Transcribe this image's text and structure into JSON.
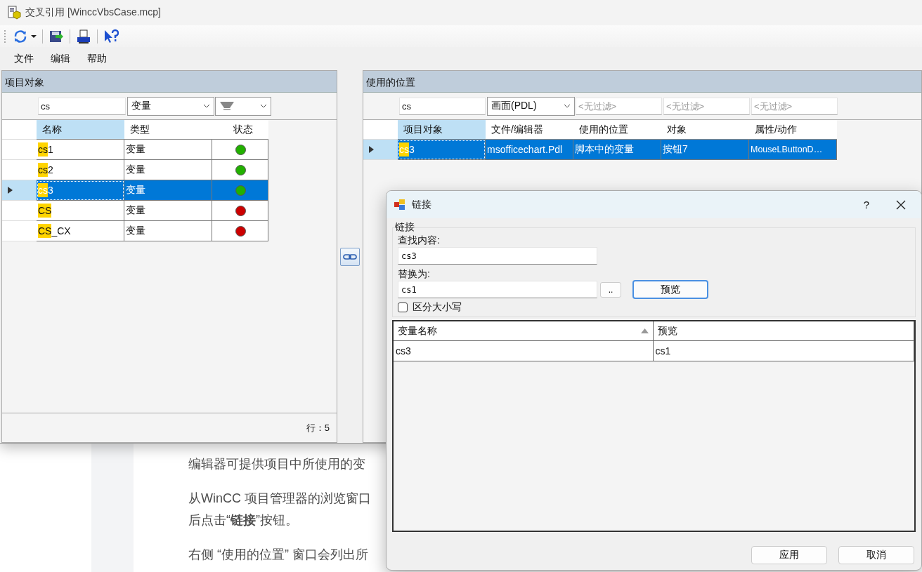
{
  "window": {
    "title": "交叉引用 [WinccVbsCase.mcp]"
  },
  "menu": [
    "文件",
    "编辑",
    "帮助"
  ],
  "left_panel": {
    "title": "项目对象",
    "filter": {
      "value": "cs",
      "type": "变量"
    },
    "columns": [
      "名称",
      "类型",
      "状态"
    ],
    "rows": [
      {
        "match": "cs",
        "rest": "1",
        "type": "变量",
        "color": "#22b000",
        "selected": false
      },
      {
        "match": "cs",
        "rest": "2",
        "type": "变量",
        "color": "#22b000",
        "selected": false
      },
      {
        "match": "cs",
        "rest": "3",
        "type": "变量",
        "color": "#22b000",
        "selected": true
      },
      {
        "match": "CS",
        "rest": "",
        "type": "变量",
        "color": "#cc0000",
        "selected": false
      },
      {
        "match": "CS",
        "rest": "_CX",
        "type": "变量",
        "color": "#cc0000",
        "selected": false
      }
    ],
    "status": "行：5"
  },
  "right_panel": {
    "title": "使用的位置",
    "filter": {
      "value": "cs",
      "type": "画面(PDL)",
      "placeholders": [
        "<无过滤>",
        "<无过滤>",
        "<无过滤>"
      ]
    },
    "columns": [
      "项目对象",
      "文件/编辑器",
      "使用的位置",
      "对象",
      "属性/动作"
    ],
    "rows": [
      {
        "cells": [
          {
            "match": "cs",
            "rest": "3"
          },
          "msofficechart.Pdl",
          "脚本中的变量",
          "按钮7",
          "MouseLButtonD…"
        ],
        "selected": true
      }
    ]
  },
  "article": [
    [
      "编辑器可提供项目中所使用的变"
    ],
    [
      "从WinCC 项目管理器的浏览窗口",
      "后点击“**链接**”按钮。"
    ],
    [
      "右侧 “使用的位置” 窗口会列出所"
    ]
  ],
  "dialog": {
    "title": "链接",
    "help": "?",
    "group": "链接",
    "find_label": "查找内容:",
    "find_value": "cs3",
    "replace_label": "替换为:",
    "replace_value": "cs1",
    "browse": "..",
    "preview_button": "预览",
    "case_label": "区分大小写",
    "case_checked": false,
    "columns": [
      "变量名称",
      "预览"
    ],
    "rows": [
      [
        "cs3",
        "cs1"
      ]
    ],
    "buttons": [
      "应用",
      "取消"
    ]
  }
}
